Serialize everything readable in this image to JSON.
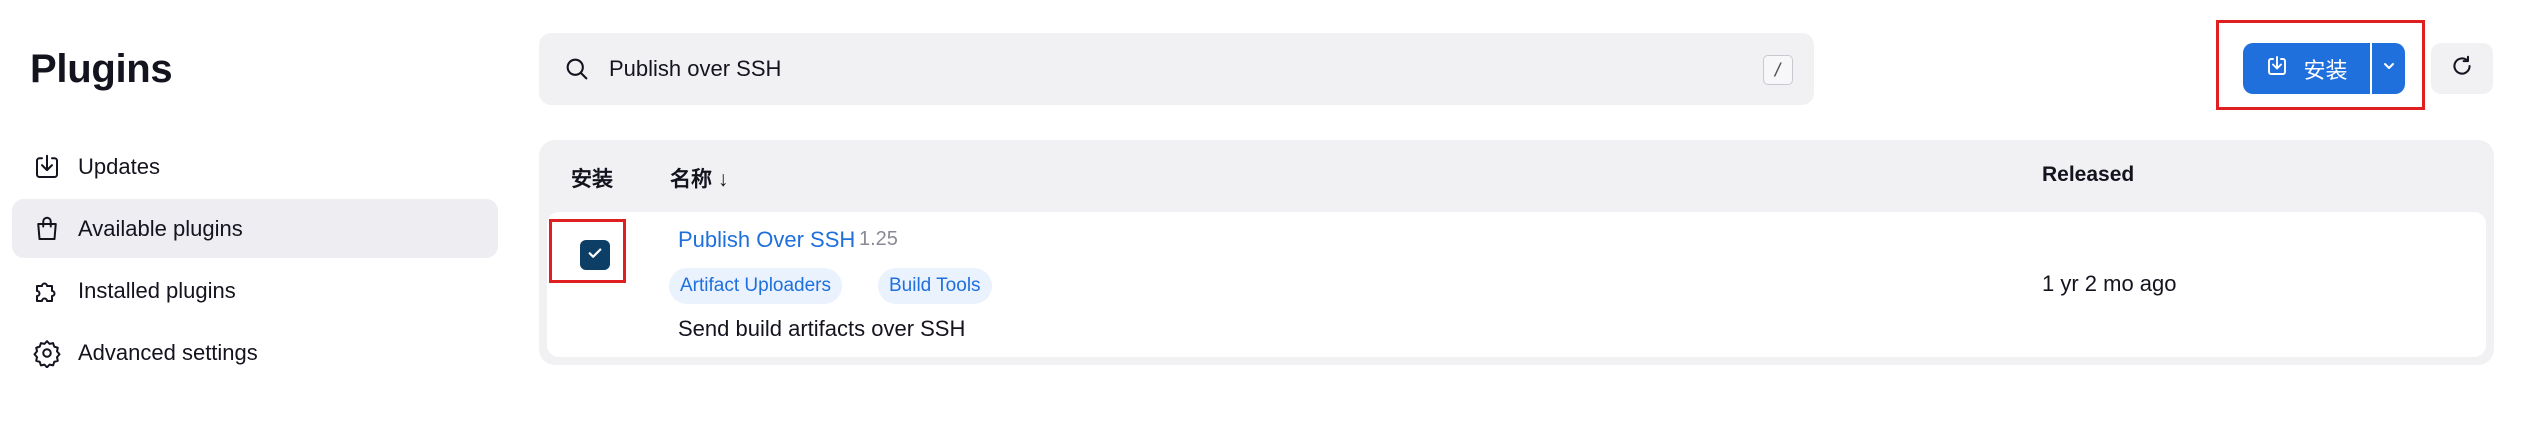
{
  "page": {
    "title": "Plugins"
  },
  "sidebar": {
    "items": [
      {
        "label": "Updates",
        "icon": "download-icon",
        "active": false
      },
      {
        "label": "Available plugins",
        "icon": "shopping-bag-icon",
        "active": true
      },
      {
        "label": "Installed plugins",
        "icon": "puzzle-icon",
        "active": false
      },
      {
        "label": "Advanced settings",
        "icon": "gear-icon",
        "active": false
      }
    ]
  },
  "search": {
    "value": "Publish over SSH",
    "shortcut": "/"
  },
  "toolbar": {
    "install_label": "安装",
    "accent": "#1f6fdd",
    "highlight": "#e02020"
  },
  "table": {
    "headers": {
      "install": "安装",
      "name": "名称 ↓",
      "released": "Released"
    },
    "rows": [
      {
        "checked": true,
        "name": "Publish Over SSH",
        "version": "1.25",
        "tags": [
          "Artifact Uploaders",
          "Build Tools"
        ],
        "description": "Send build artifacts over SSH",
        "released": "1 yr 2 mo ago"
      }
    ]
  }
}
